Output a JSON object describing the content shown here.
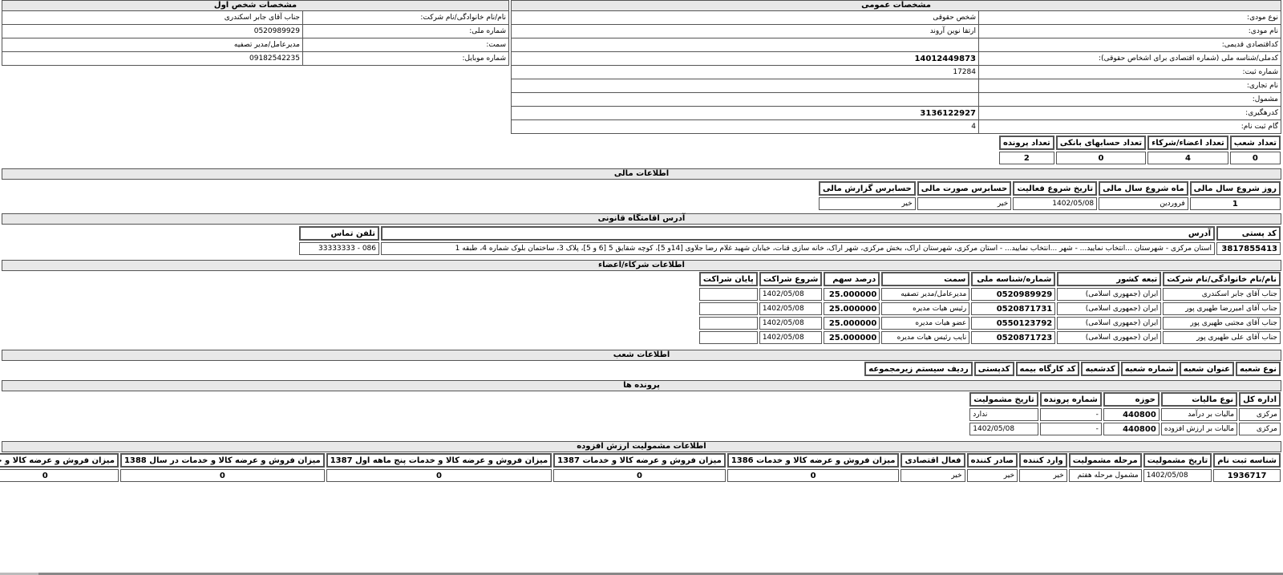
{
  "general": {
    "title": "مشخصات عمومی",
    "rows": [
      {
        "key": "نوع مودی:",
        "value": "شخص حقوقی"
      },
      {
        "key": "نام مودی:",
        "value": "ارتقا نوین آروند"
      },
      {
        "key": "کداقتصادی قدیمی:",
        "value": ""
      },
      {
        "key": "کدملی/شناسه ملی (شماره اقتصادی برای اشخاص حقوقی):",
        "value": "14012449873"
      },
      {
        "key": "شماره ثبت:",
        "value": "17284"
      },
      {
        "key": "نام تجاری:",
        "value": ""
      },
      {
        "key": "مشمول:",
        "value": ""
      },
      {
        "key": "کدرهگیری:",
        "value": "3136122927"
      },
      {
        "key": "گام ثبت نام:",
        "value": "4"
      }
    ]
  },
  "first_person": {
    "title": "مشخصات شخص اول",
    "rows": [
      {
        "key": "نام/نام خانوادگی/نام شرکت:",
        "value": "جناب آقای جابر اسکندری"
      },
      {
        "key": "شماره ملی:",
        "value": "0520989929"
      },
      {
        "key": "سمت:",
        "value": "مدیرعامل/مدیر تصفیه"
      },
      {
        "key": "شماره موبایل:",
        "value": "09182542235"
      }
    ]
  },
  "counts": {
    "headers": [
      "تعداد شعب",
      "تعداد اعضاء/شرکاء",
      "تعداد حسابهای بانکی",
      "تعداد پرونده"
    ],
    "values": [
      "0",
      "4",
      "0",
      "2"
    ]
  },
  "financial": {
    "title": "اطلاعات مالی",
    "headers": [
      "روز شروع سال مالی",
      "ماه شروع سال مالی",
      "تاریخ شروع فعالیت",
      "حسابرس صورت مالی",
      "حسابرس گزارش مالی"
    ],
    "values": [
      "1",
      "فروردین",
      "1402/05/08",
      "خیر",
      "خیر"
    ]
  },
  "address": {
    "title": "آدرس اقامتگاه قانونی",
    "headers": [
      "کد پستی",
      "آدرس",
      "تلفن تماس"
    ],
    "values": [
      "3817855413",
      "استان مرکزی - شهرستان ...انتخاب نمایید... - شهر ...انتخاب نمایید... - استان مرکزی، شهرستان اراک، بخش مرکزی، شهر اراک، خانه سازی قنات، خیابان شهید غلام رضا جلاوی [14و 5]، کوچه شقایق 5 [6 و 5]، پلاک 3، ساختمان بلوک شماره 4، طبقه 1",
      "086 - 33333333"
    ]
  },
  "partners": {
    "title": "اطلاعات شرکاء/اعضاء",
    "headers": [
      "نام/نام خانوادگی/نام شرکت",
      "تبعه کشور",
      "شماره/شناسه ملی",
      "سمت",
      "درصد سهم",
      "شروع شراکت",
      "پایان شراکت"
    ],
    "rows": [
      [
        "جناب آقای جابر اسکندری",
        "ایران (جمهوری اسلامی)",
        "0520989929",
        "مدیرعامل/مدیر تصفیه",
        "25.000000",
        "1402/05/08",
        ""
      ],
      [
        "جناب آقای امیررضا طهیری پور",
        "ایران (جمهوری اسلامی)",
        "0520871731",
        "رئیس هیات مدیره",
        "25.000000",
        "1402/05/08",
        ""
      ],
      [
        "جناب آقای مجتبی طهیری پور",
        "ایران (جمهوری اسلامی)",
        "0550123792",
        "عضو هیات مدیره",
        "25.000000",
        "1402/05/08",
        ""
      ],
      [
        "جناب آقای علی طهیری پور",
        "ایران (جمهوری اسلامی)",
        "0520871723",
        "نایب رئیس هیات مدیره",
        "25.000000",
        "1402/05/08",
        ""
      ]
    ]
  },
  "branches": {
    "title": "اطلاعات شعب",
    "headers": [
      "نوع شعبه",
      "عنوان شعبه",
      "شماره شعبه",
      "کدشعبه",
      "کد کارگاه بیمه",
      "کدپستی",
      "ردیف سیستم زیرمجموعه"
    ]
  },
  "files": {
    "title": "پرونده ها",
    "headers": [
      "اداره کل",
      "نوع مالیات",
      "حوزه",
      "شماره پرونده",
      "تاریخ مشمولیت"
    ],
    "rows": [
      [
        "مرکزی",
        "مالیات بر درآمد",
        "440800",
        "-",
        "ندارد"
      ],
      [
        "مرکزی",
        "مالیات بر ارزش افزوده",
        "440800",
        "-",
        "1402/05/08"
      ]
    ]
  },
  "vat": {
    "title": "اطلاعات مشمولیت ارزش افزوده",
    "headers": [
      "شناسه ثبت نام",
      "تاریخ مشمولیت",
      "مرحله مشمولیت",
      "وارد کننده",
      "صادر کننده",
      "فعال اقتصادی",
      "میزان فروش و عرضه کالا و خدمات 1386",
      "میزان فروش و عرضه کالا و خدمات 1387",
      "میزان فروش و عرضه کالا و خدمات پنج ماهه اول 1387",
      "میزان فروش و عرضه کالا و خدمات در سال 1388",
      "میزان فروش و عرضه کالا و خدمات"
    ],
    "values": [
      "1936717",
      "1402/05/08",
      "مشمول مرحله هفتم",
      "خیر",
      "خیر",
      "خیر",
      "0",
      "0",
      "0",
      "0",
      "0"
    ]
  }
}
